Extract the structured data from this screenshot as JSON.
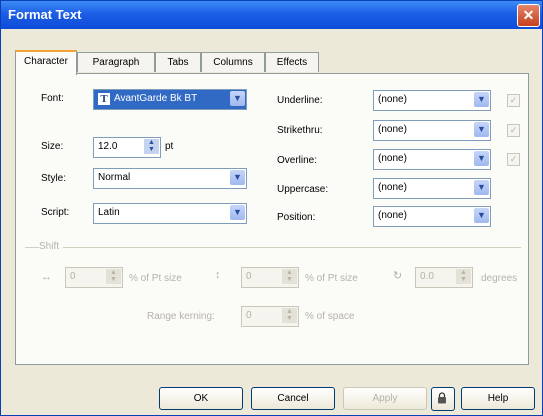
{
  "window": {
    "title": "Format Text",
    "close_glyph": "✕"
  },
  "tabs": [
    "Character",
    "Paragraph",
    "Tabs",
    "Columns",
    "Effects"
  ],
  "character": {
    "font": {
      "label": "Font:",
      "value": "AvantGarde Bk BT",
      "icon": "truetype-font-icon"
    },
    "size": {
      "label": "Size:",
      "value": "12.0",
      "unit": "pt"
    },
    "style": {
      "label": "Style:",
      "value": "Normal"
    },
    "script": {
      "label": "Script:",
      "value": "Latin"
    },
    "underline": {
      "label": "Underline:",
      "value": "(none)"
    },
    "strikethru": {
      "label": "Strikethru:",
      "value": "(none)"
    },
    "overline": {
      "label": "Overline:",
      "value": "(none)"
    },
    "uppercase": {
      "label": "Uppercase:",
      "value": "(none)"
    },
    "position": {
      "label": "Position:",
      "value": "(none)"
    }
  },
  "shift": {
    "group_label": "Shift",
    "horizontal": {
      "value": "0",
      "unit": "% of Pt size"
    },
    "vertical": {
      "value": "0",
      "unit": "% of Pt size"
    },
    "rotation": {
      "value": "0.0",
      "unit": "degrees"
    },
    "range_kerning": {
      "label": "Range kerning:",
      "value": "0",
      "unit": "% of space"
    }
  },
  "buttons": {
    "ok": "OK",
    "cancel": "Cancel",
    "apply": "Apply",
    "help": "Help"
  },
  "colors": {
    "titlebar": "#1c5ee6",
    "selection": "#316ac5",
    "dialog_bg": "#ece9d8"
  }
}
